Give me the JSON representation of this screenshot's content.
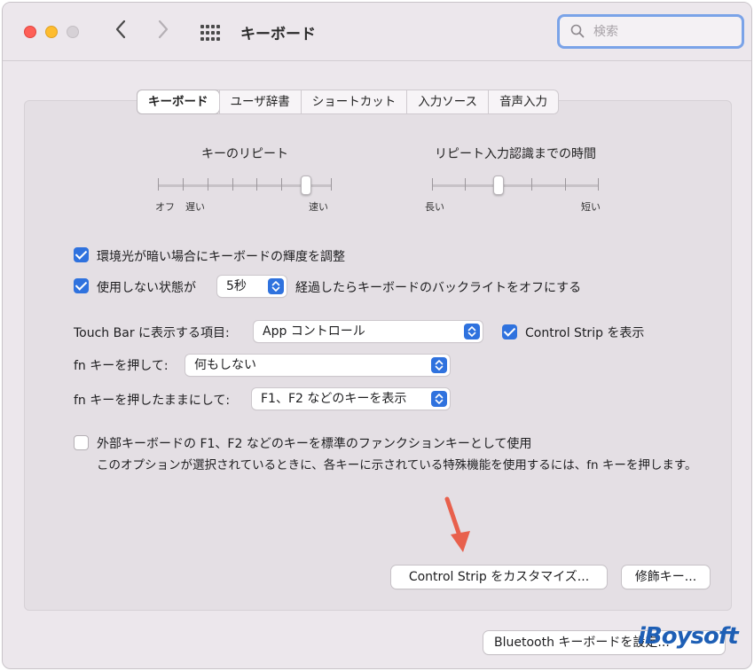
{
  "window": {
    "title": "キーボード"
  },
  "search": {
    "placeholder": "検索"
  },
  "tabs": [
    {
      "label": "キーボード",
      "active": true
    },
    {
      "label": "ユーザ辞書",
      "active": false
    },
    {
      "label": "ショートカット",
      "active": false
    },
    {
      "label": "入力ソース",
      "active": false
    },
    {
      "label": "音声入力",
      "active": false
    }
  ],
  "key_repeat": {
    "title": "キーのリピート",
    "label_off": "オフ",
    "label_slow": "遅い",
    "label_fast": "速い",
    "ticks": 8,
    "value_step": 7
  },
  "repeat_delay": {
    "title": "リピート入力認識までの時間",
    "label_long": "長い",
    "label_short": "短い",
    "ticks": 6,
    "value_step": 3
  },
  "options": {
    "adjust_brightness": {
      "label": "環境光が暗い場合にキーボードの輝度を調整",
      "checked": true
    },
    "backlight_off": {
      "label_prefix": "使用しない状態が",
      "value": "5秒",
      "label_suffix": "経過したらキーボードのバックライトをオフにする",
      "checked": true
    }
  },
  "touchbar": {
    "label": "Touch Bar に表示する項目:",
    "value": "App コントロール",
    "show_control_strip": {
      "label": "Control Strip を表示",
      "checked": true
    }
  },
  "fn_press": {
    "label": "fn キーを押して:",
    "value": "何もしない"
  },
  "fn_hold": {
    "label": "fn キーを押したままにして:",
    "value": "F1、F2 などのキーを表示"
  },
  "function_keys": {
    "label": "外部キーボードの F1、F2 などのキーを標準のファンクションキーとして使用",
    "checked": false,
    "note": "このオプションが選択されているときに、各キーに示されている特殊機能を使用するには、fn キーを押します。"
  },
  "buttons": {
    "customize_control_strip": "Control Strip をカスタマイズ...",
    "modifier_keys": "修飾キー...",
    "bluetooth": "Bluetooth キーボードを設定..."
  },
  "watermark": "iBoysoft",
  "colors": {
    "accent": "#2f72de",
    "arrow": "#e8604c",
    "search_ring": "#7aa3e8"
  }
}
